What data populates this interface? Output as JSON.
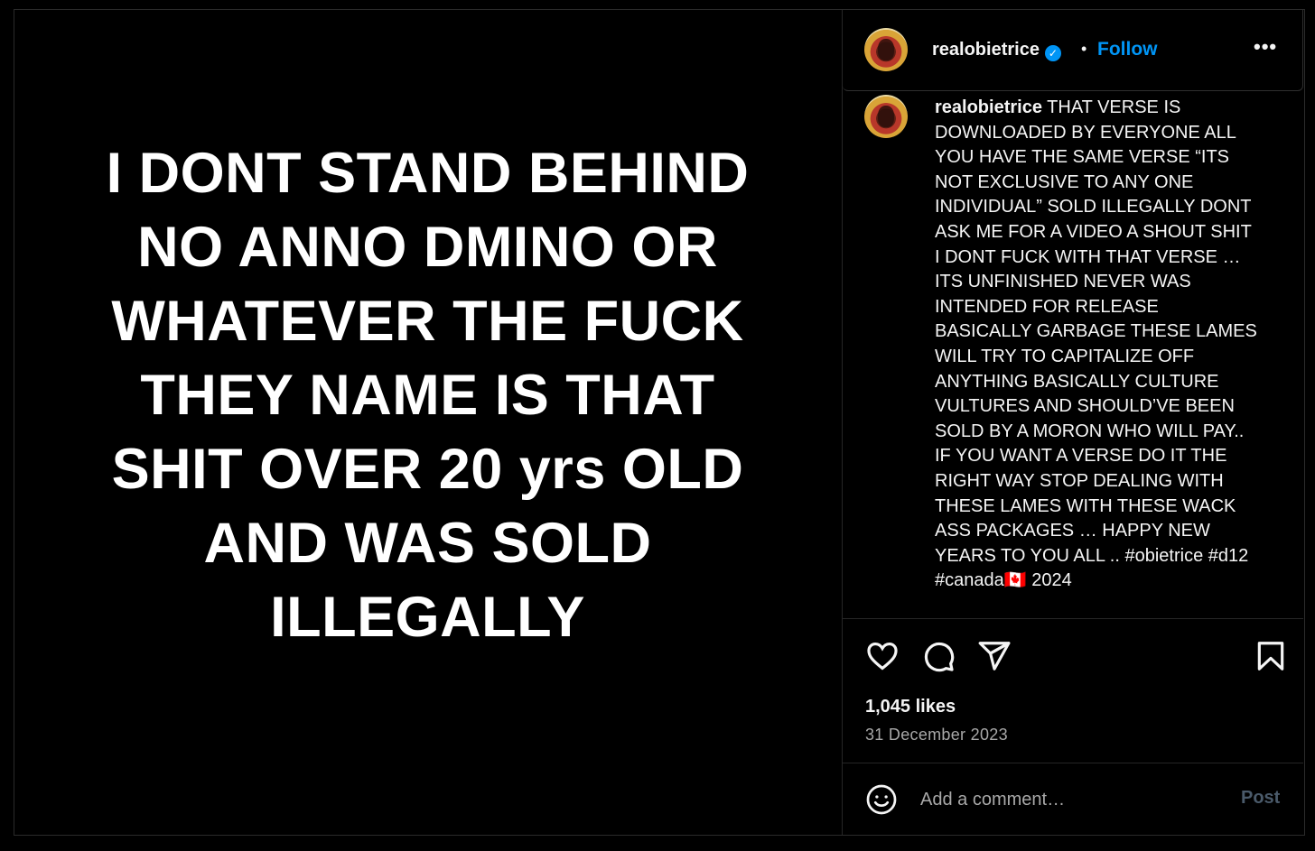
{
  "post": {
    "image_text": "I DONT STAND BEHIND NO ANNO DMINO OR WHATEVER THE FUCK THEY NAME IS THAT SHIT OVER 20 yrs OLD AND WAS SOLD ILLEGALLY"
  },
  "header": {
    "username": "realobietrice",
    "verified_glyph": "✓",
    "separator": "•",
    "follow_label": "Follow",
    "more_label": "•••"
  },
  "caption": {
    "username": "realobietrice",
    "text": "THAT VERSE IS DOWNLOADED BY EVERYONE ALL YOU HAVE THE SAME VERSE “ITS NOT EXCLUSIVE TO ANY ONE INDIVIDUAL” SOLD ILLEGALLY DONT ASK ME FOR A VIDEO A SHOUT SHIT I DONT FUCK WITH THAT VERSE … ITS UNFINISHED NEVER WAS INTENDED FOR RELEASE BASICALLY GARBAGE THESE LAMES WILL TRY TO CAPITALIZE OFF ANYTHING BASICALLY CULTURE VULTURES AND SHOULD’VE BEEN SOLD BY A MORON WHO WILL PAY.. IF YOU WANT A VERSE DO IT THE RIGHT WAY STOP DEALING WITH THESE LAMES WITH THESE WACK ASS PACKAGES … HAPPY NEW YEARS TO YOU ALL .. #obietrice #d12 #canada🇨🇦 2024"
  },
  "stats": {
    "likes": "1,045 likes",
    "date": "31 December 2023"
  },
  "comment": {
    "placeholder": "Add a comment…",
    "post_label": "Post"
  },
  "icons": {
    "like": "heart-icon",
    "comment": "comment-bubble-icon",
    "share": "send-icon",
    "save": "bookmark-icon",
    "emoji": "emoji-smile-icon"
  },
  "colors": {
    "accent": "#0095f6",
    "background": "#000000",
    "muted_text": "#a8a8a8",
    "post_disabled": "#4a5a6a"
  }
}
